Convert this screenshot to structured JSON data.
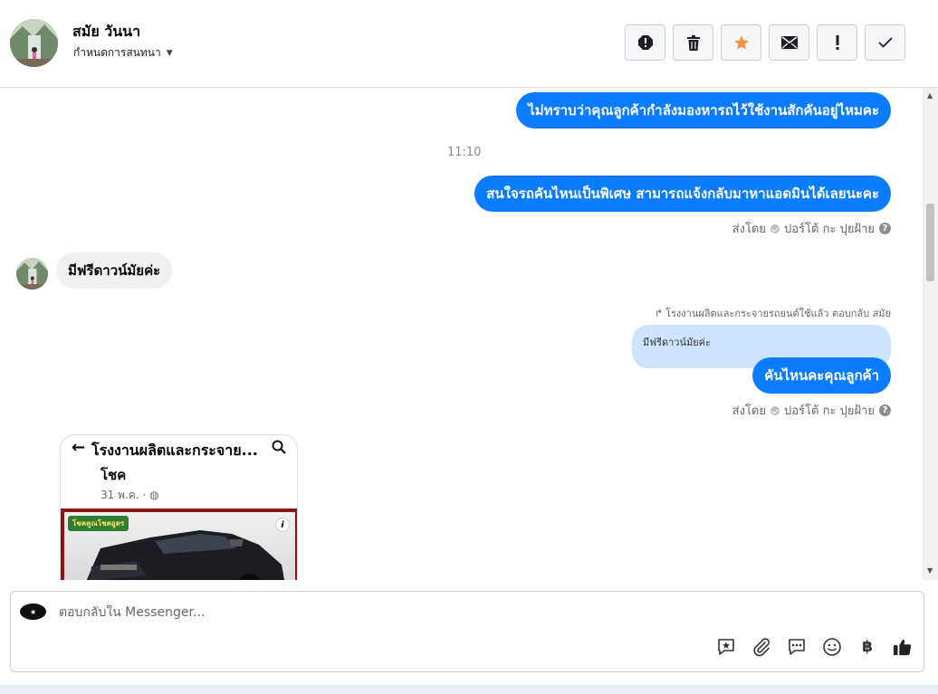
{
  "contact": {
    "name": "สมัย วันนา",
    "assign_label": "กำหนดการสนทนา"
  },
  "actions": [
    {
      "icon": "alert-icon",
      "label": "spam"
    },
    {
      "icon": "trash-icon",
      "label": "delete"
    },
    {
      "icon": "star-icon",
      "label": "follow up"
    },
    {
      "icon": "envelope-icon",
      "label": "mark unread"
    },
    {
      "icon": "exclamation-icon",
      "label": "priority"
    },
    {
      "icon": "check-icon",
      "label": "done"
    }
  ],
  "messages": {
    "m1": "ไม่ทราบว่าคุณลูกค้ากำลังมองหารถไว้ใช้งานสักคันอยู่ไหมคะ",
    "time1": "11:10",
    "m2": "สนใจรถคันไหนเป็นพิเศษ สามารถแจ้งกลับมาหาแอดมินได้เลยนะคะ",
    "sent_by_label": "ส่งโดย",
    "sent_by_name": "ปอร์โต้ กะ ปุยฝ้าย",
    "m3": "มีฟรีดาวน์มัยค่ะ",
    "reply_header": "โรงงานผลิตและกระจายรถยนต์ใช้แล้ว ตอบกลับ สมัย",
    "quoted": "มีฟรีดาวน์มัยค่ะ",
    "m4": "คันไหนคะคุณลูกค้า"
  },
  "shared_post": {
    "title": "โรงงานผลิตและกระจาย...",
    "name": "โชค",
    "date": "31 พ.ค. ·",
    "tag": "โชคคูณโชคอูตร"
  },
  "composer": {
    "placeholder": "ตอบกลับใน Messenger..."
  },
  "colors": {
    "accent": "#0a7cff",
    "star": "#f7923b"
  }
}
